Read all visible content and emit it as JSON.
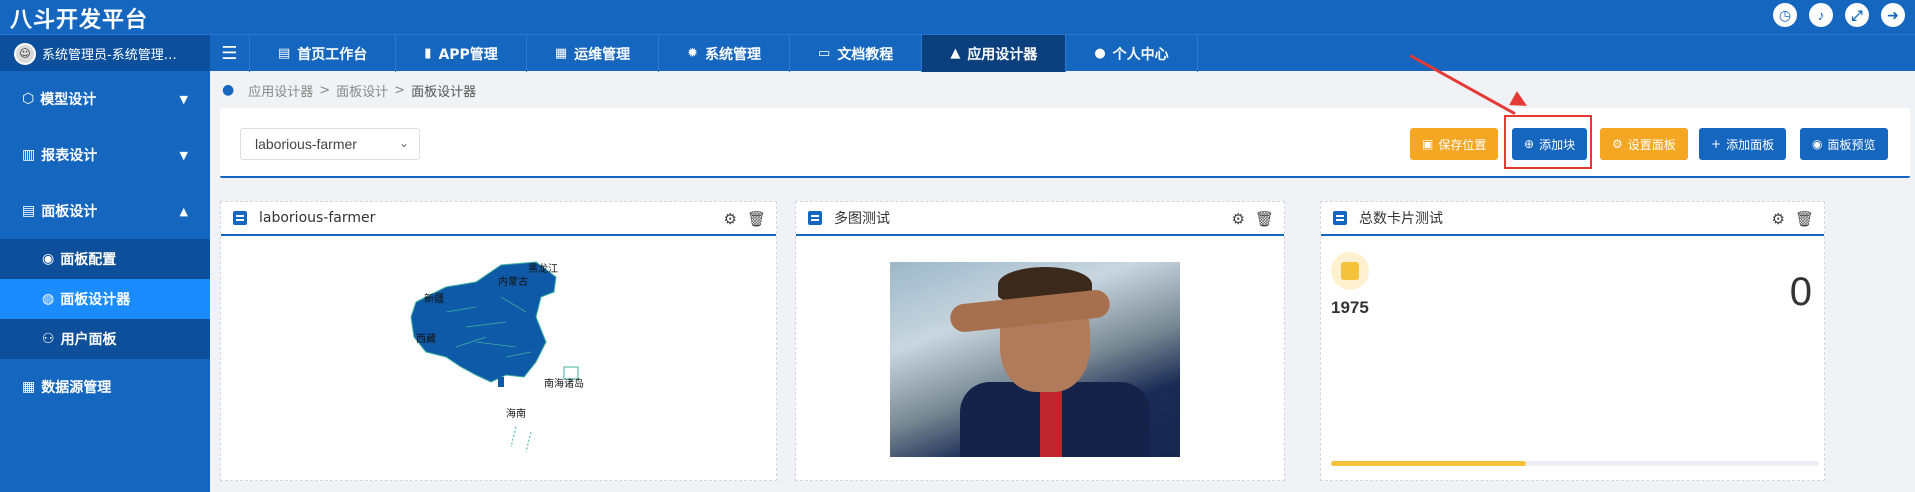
{
  "app": {
    "title": "八斗开发平台"
  },
  "header": {
    "icons": [
      "clock-icon",
      "bell-icon",
      "fullscreen-icon",
      "logout-icon"
    ]
  },
  "user": {
    "name": "系统管理员-系统管理…"
  },
  "nav": {
    "tabs": [
      {
        "label": "首页工作台",
        "icon": "home-icon",
        "active": false
      },
      {
        "label": "APP管理",
        "icon": "phone-icon",
        "active": false
      },
      {
        "label": "运维管理",
        "icon": "clipboard-icon",
        "active": false
      },
      {
        "label": "系统管理",
        "icon": "gear-icon",
        "active": false
      },
      {
        "label": "文档教程",
        "icon": "book-icon",
        "active": false
      },
      {
        "label": "应用设计器",
        "icon": "designer-icon",
        "active": true
      },
      {
        "label": "个人中心",
        "icon": "user-icon",
        "active": false
      }
    ]
  },
  "sidebar": {
    "items": [
      {
        "label": "模型设计",
        "expanded": false
      },
      {
        "label": "报表设计",
        "expanded": false
      },
      {
        "label": "面板设计",
        "expanded": true
      }
    ],
    "sub_items": [
      {
        "label": "面板配置",
        "active": false
      },
      {
        "label": "面板设计器",
        "active": true
      },
      {
        "label": "用户面板",
        "active": false
      }
    ],
    "last_item": {
      "label": "数据源管理"
    }
  },
  "breadcrumb": {
    "level1": "应用设计器",
    "sep": ">",
    "level2": "面板设计",
    "current": "面板设计器"
  },
  "toolbar": {
    "selected_panel": "laborious-farmer",
    "save_position": "保存位置",
    "add_block": "添加块",
    "set_panel": "设置面板",
    "add_panel": "添加面板",
    "preview_panel": "面板预览"
  },
  "cards": {
    "map": {
      "title": "laborious-farmer",
      "labels": [
        "内蒙古",
        "黑龙江",
        "新疆",
        "西藏",
        "南海诸岛",
        "海南"
      ]
    },
    "image": {
      "title": "多图测试"
    },
    "kpi": {
      "title": "总数卡片测试",
      "label": "1975",
      "value": "0",
      "progress": 0.4
    }
  },
  "colors": {
    "primary": "#1566bf",
    "dark_nav": "#0b3f7e",
    "orange": "#f5a623",
    "highlight": "#e53935"
  }
}
